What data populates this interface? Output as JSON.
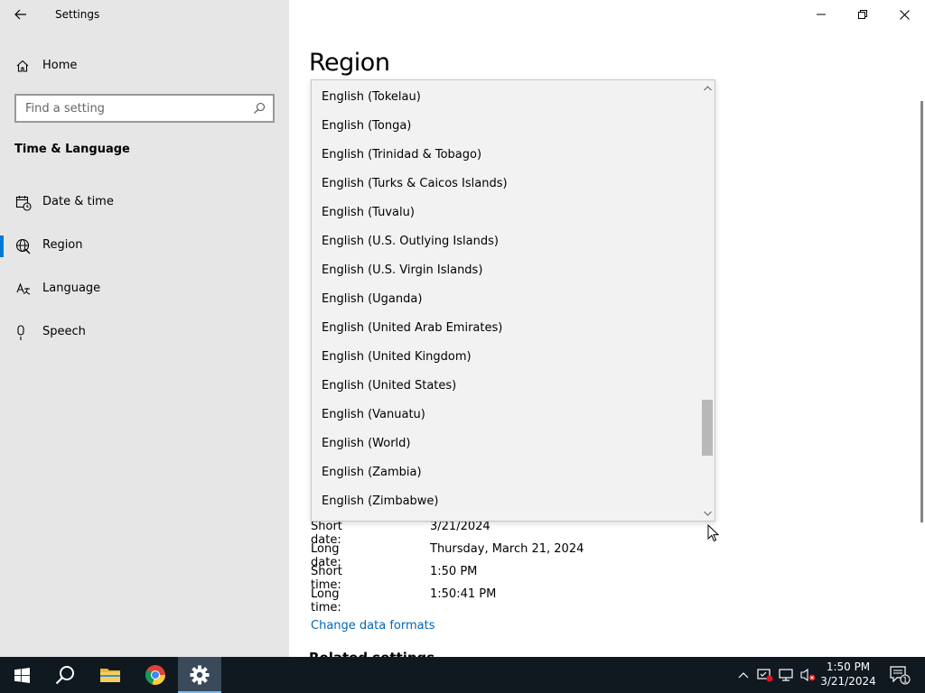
{
  "window": {
    "app_title": "Settings"
  },
  "sidebar": {
    "home_label": "Home",
    "search_placeholder": "Find a setting",
    "section_title": "Time & Language",
    "items": [
      {
        "label": "Date & time",
        "icon": "calendar-clock-icon"
      },
      {
        "label": "Region",
        "icon": "globe-icon",
        "selected": true
      },
      {
        "label": "Language",
        "icon": "language-icon"
      },
      {
        "label": "Speech",
        "icon": "microphone-icon"
      }
    ]
  },
  "main": {
    "page_title": "Region",
    "dropdown": {
      "options": [
        "English (Tokelau)",
        "English (Tonga)",
        "English (Trinidad & Tobago)",
        "English (Turks & Caicos Islands)",
        "English (Tuvalu)",
        "English (U.S. Outlying Islands)",
        "English (U.S. Virgin Islands)",
        "English (Uganda)",
        "English (United Arab Emirates)",
        "English (United Kingdom)",
        "English (United States)",
        "English (Vanuatu)",
        "English (World)",
        "English (Zambia)",
        "English (Zimbabwe)"
      ],
      "scroll_position_fraction": 0.86
    },
    "formats": [
      {
        "key": "Short date:",
        "value": "3/21/2024"
      },
      {
        "key": "Long date:",
        "value": "Thursday, March 21, 2024"
      },
      {
        "key": "Short time:",
        "value": "1:50 PM"
      },
      {
        "key": "Long time:",
        "value": "1:50:41 PM"
      }
    ],
    "change_link": "Change data formats",
    "related_settings": "Related settings"
  },
  "taskbar": {
    "pinned": [
      {
        "name": "start-button",
        "icon": "windows-logo-icon"
      },
      {
        "name": "search-button",
        "icon": "search-icon"
      },
      {
        "name": "file-explorer-button",
        "icon": "folder-icon"
      },
      {
        "name": "chrome-button",
        "icon": "chrome-icon"
      },
      {
        "name": "settings-taskbar-button",
        "icon": "gear-icon",
        "active": true
      }
    ],
    "time": "1:50 PM",
    "date": "3/21/2024",
    "notification_count": "1"
  },
  "colors": {
    "accent": "#0078d7",
    "sidebar_bg": "#e6e6e6",
    "taskbar_bg": "#101820",
    "link": "#0067b8"
  }
}
